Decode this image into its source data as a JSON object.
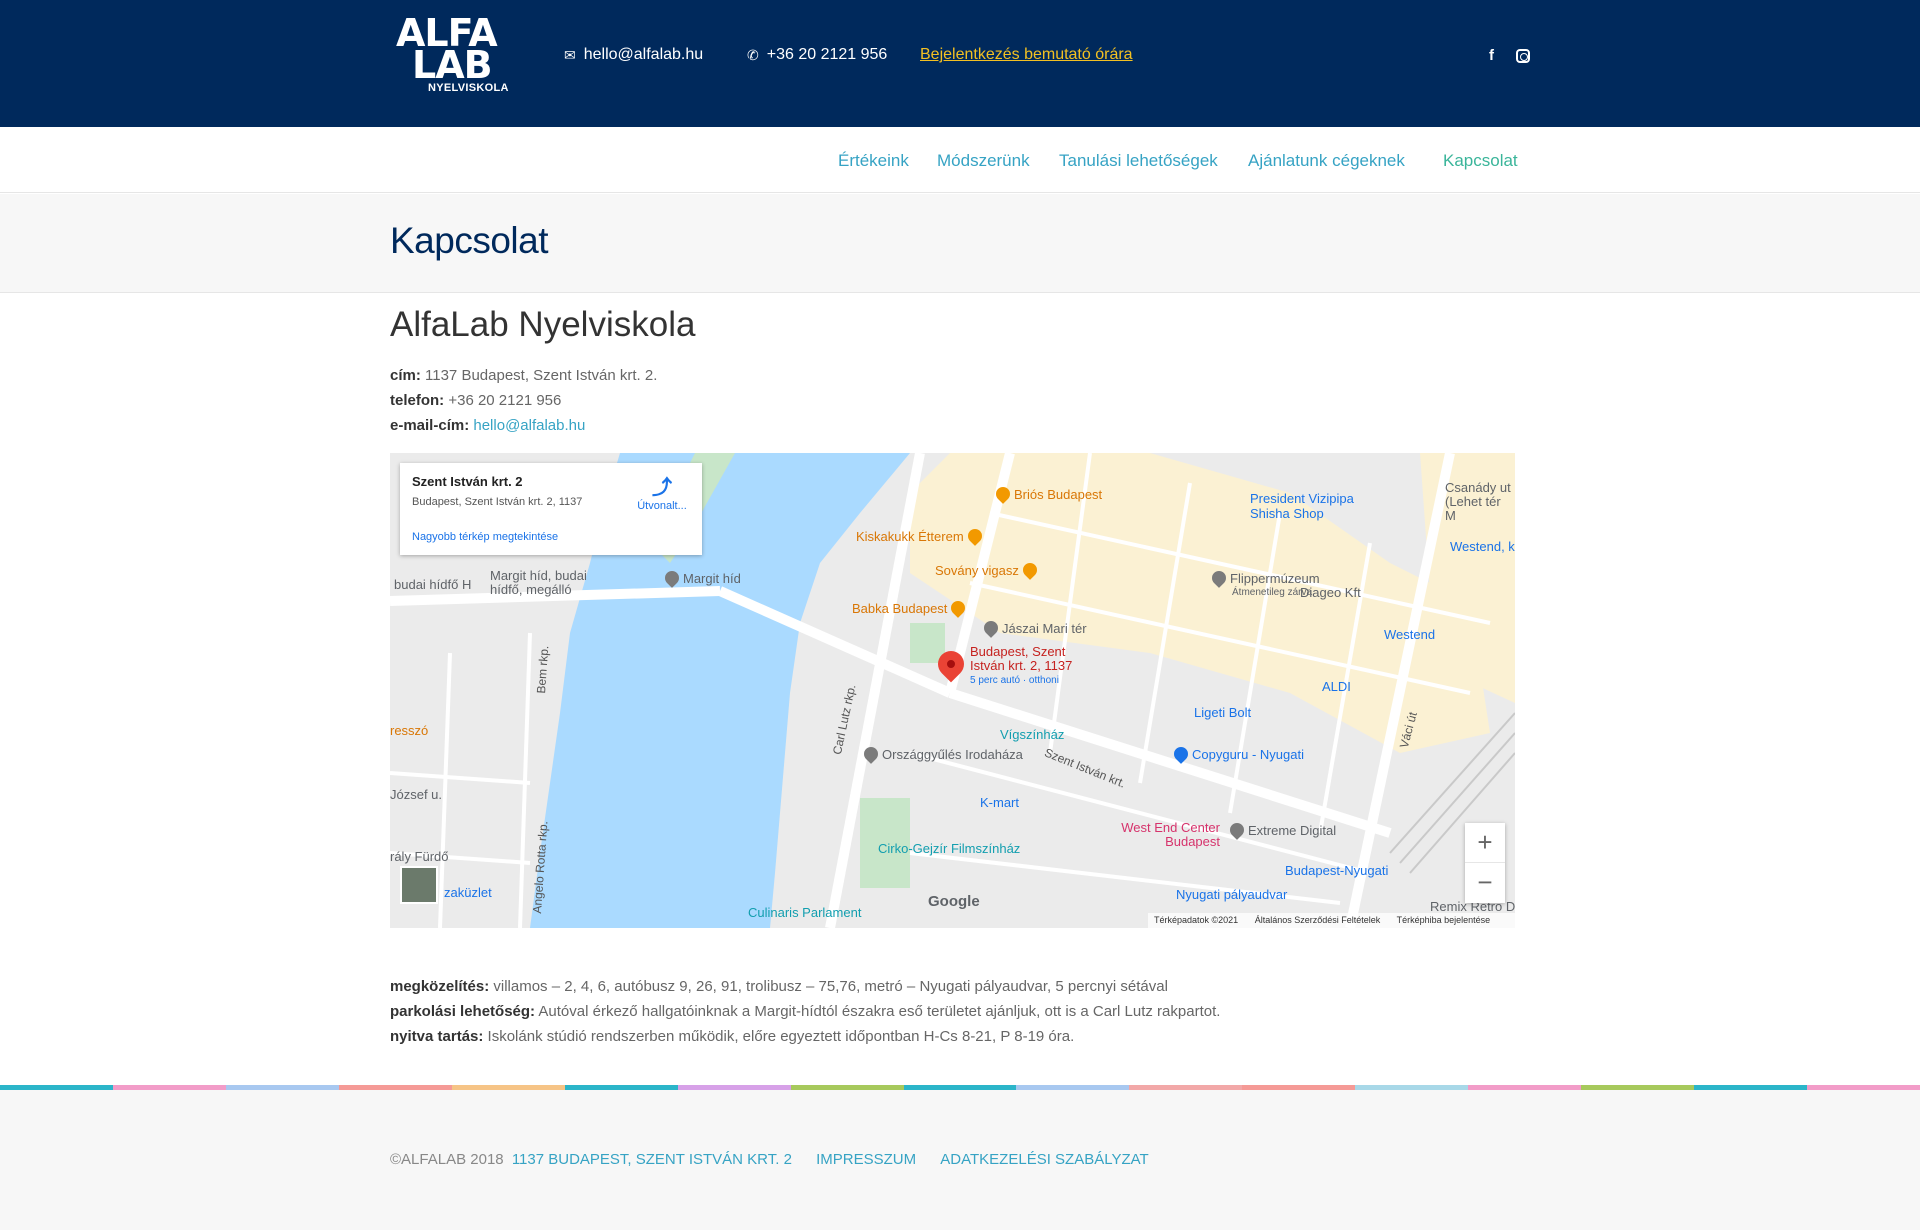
{
  "header": {
    "logo_line1": "ALFA",
    "logo_line2": "LAB",
    "logo_line3": "NYELVISKOLA",
    "email": "hello@alfalab.hu",
    "phone": "+36 20 2121 956",
    "demo_link": "Bejelentkezés bemutató órára",
    "facebook_icon": "f"
  },
  "nav": {
    "items": [
      {
        "label": "Értékeink"
      },
      {
        "label": "Módszerünk"
      },
      {
        "label": "Tanulási lehetőségek"
      },
      {
        "label": "Ajánlatunk cégeknek"
      },
      {
        "label": "Kapcsolat"
      }
    ]
  },
  "page_title": "Kapcsolat",
  "org_name": "AlfaLab Nyelviskola",
  "info": {
    "address_label": "cím:",
    "address": "1137 Budapest, Szent István krt. 2.",
    "phone_label": "telefon:",
    "phone": "+36 20 2121 956",
    "email_label": "e-mail-cím:",
    "email": "hello@alfalab.hu"
  },
  "map": {
    "card_title": "Szent István krt. 2",
    "card_address": "Budapest, Szent István krt. 2, 1137",
    "card_directions": "Útvonalt...",
    "card_larger": "Nagyobb térkép megtekintése",
    "pin_label": "Budapest, Szent István krt. 2, 1137",
    "pin_sub": "5 perc autó · otthoni",
    "zoom_in": "+",
    "zoom_out": "−",
    "google": "Google",
    "attrib_data": "Térképadatok ©2021",
    "attrib_terms": "Általános Szerződési Feltételek",
    "attrib_report": "Térképhiba bejelentése",
    "labels": {
      "brios": "Briós Budapest",
      "kiskakukk": "Kiskakukk Étterem",
      "sovany": "Sovány vigasz",
      "babka": "Babka Budapest",
      "jaszai": "Jászai Mari tér",
      "margit_hid": "Margit híd",
      "margit_hid_budai": "Margit híd, budai hídfő, megálló",
      "budai_hidfo": "budai hídfő H",
      "president": "President Vizipipa Shisha Shop",
      "flipper": "Flippermúzeum",
      "flipper_sub": "Átmenetileg zárva",
      "diageo": "Diageo Kft",
      "westend": "Westend",
      "westend_k": "Westend, k",
      "aldi": "ALDI",
      "ligeti": "Ligeti Bolt",
      "vigszinhaz": "Vígszínház",
      "copyguru": "Copyguru - Nyugati",
      "orszaggyules": "Országgyűlés Irodaháza",
      "kmart": "K-mart",
      "westend_center": "West End Center Budapest",
      "extreme": "Extreme Digital",
      "cirko": "Cirko-Gejzír Filmszínház",
      "bp_nyugati": "Budapest-Nyugati",
      "nyugati_pu": "Nyugati pályaudvar",
      "culinaris": "Culinaris Parlament",
      "remix": "Remix Retro D",
      "csanady": "Csanády ut (Lehet tér M",
      "jozsef": "József u.",
      "kiraly": "rály Fürdő",
      "uzlet": "zaküzlet",
      "presszo": "resszó",
      "carl_lutz": "Carl Lutz rkp.",
      "szent_istvan": "Szent István krt.",
      "vaci": "Váci út",
      "bem": "Bem rkp.",
      "angelo": "Angelo Rotta rkp."
    }
  },
  "details": {
    "approach_label": "megközelítés:",
    "approach": "villamos – 2, 4, 6, autóbusz 9, 26, 91, trolibusz – 75,76, metró – Nyugati pályaudvar, 5 percnyi sétával",
    "parking_label": "parkolási lehetőség:",
    "parking": "Autóval érkező hallgatóinknak a Margit-hídtól északra eső területet ajánljuk, ott is a Carl Lutz rakpartot.",
    "hours_label": "nyitva tartás:",
    "hours": "Iskolánk stúdió rendszerben működik, előre egyeztett időpontban H-Cs 8-21, P 8-19 óra."
  },
  "footer": {
    "copyright": "©ALFALAB 2018",
    "address": "1137 BUDAPEST, SZENT ISTVÁN KRT. 2",
    "impresszum": "IMPRESSZUM",
    "adatkezeles": "ADATKEZELÉSI SZABÁLYZAT"
  },
  "colors": {
    "header_bg": "#00295c",
    "accent_blue": "#36a3c4",
    "accent_green": "#3ab59a",
    "accent_yellow": "#f3c022",
    "stripe": [
      "#2bb5c9",
      "#f29cc8",
      "#a8c8f0",
      "#f59a96",
      "#f6c486",
      "#2bb5c9",
      "#d7a1e8",
      "#a7c95c",
      "#2bb5c9",
      "#a8c8f0",
      "#f2a8a8",
      "#f59a96",
      "#a8d8e8",
      "#f29cc8",
      "#a7c95c",
      "#2bb5c9",
      "#f29cc8"
    ]
  },
  "icons": [
    "envelope-icon",
    "phone-icon",
    "facebook-icon",
    "instagram-icon",
    "directions-icon",
    "map-pin-icon"
  ]
}
